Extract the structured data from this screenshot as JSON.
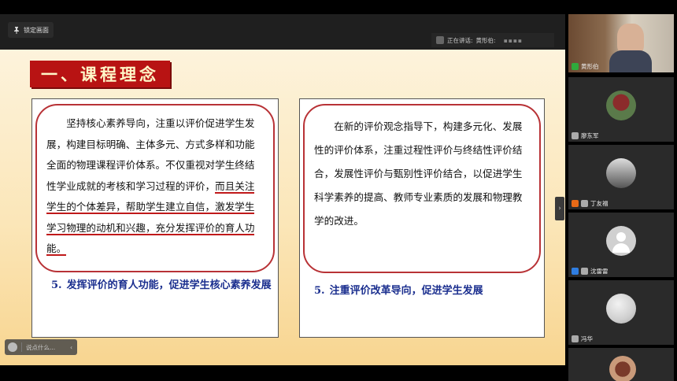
{
  "toolbar": {
    "lock_label": "锁定画面"
  },
  "speaking": {
    "prefix": "正在讲话:",
    "name": "黄形伯:",
    "dots": "▪▪▪▪"
  },
  "slide": {
    "title": "一、课程理念",
    "left_panel": {
      "para_plain": "坚持核心素养导向，注重以评价促进学生发展，构建目标明确、主体多元、方式多样和功能全面的物理课程评价体系。不仅重视对学生终结性学业成就的考核和学习过程的评价，",
      "para_underlined": "而且关注学生的个体差异，帮助学生建立自信，激发学生学习物理的动机和兴趣，充分发挥评价的育人功能。",
      "sub_num": "5.",
      "sub_text": "发挥评价的育人功能，促进学生核心素养发展"
    },
    "right_panel": {
      "para": "在新的评价观念指导下，构建多元化、发展性的评价体系，注重过程性评价与终结性评价结合，发展性评价与甄别性评价结合，以促进学生科学素养的提高、教师专业素质的发展和物理教学的改进。",
      "sub_num": "5.",
      "sub_text": "注重评价改革导向，促进学生发展"
    }
  },
  "chat": {
    "placeholder": "说点什么...",
    "chevron": "‹"
  },
  "expand": "›",
  "participants": [
    {
      "name": "黄形伯",
      "icon": "mic-icon",
      "icon_color": "#2faa3c"
    },
    {
      "name": "廖东军",
      "icon": "mic-muted-icon",
      "icon_color": "#aaaaaa"
    },
    {
      "name": "丁友福",
      "icon": "host-icon",
      "icon_color": "#e86a17"
    },
    {
      "name": "沈雷雷",
      "icon": "user-icon",
      "icon_color": "#2f7de0"
    },
    {
      "name": "冯华",
      "icon": "mic-muted-icon",
      "icon_color": "#aaaaaa"
    }
  ]
}
